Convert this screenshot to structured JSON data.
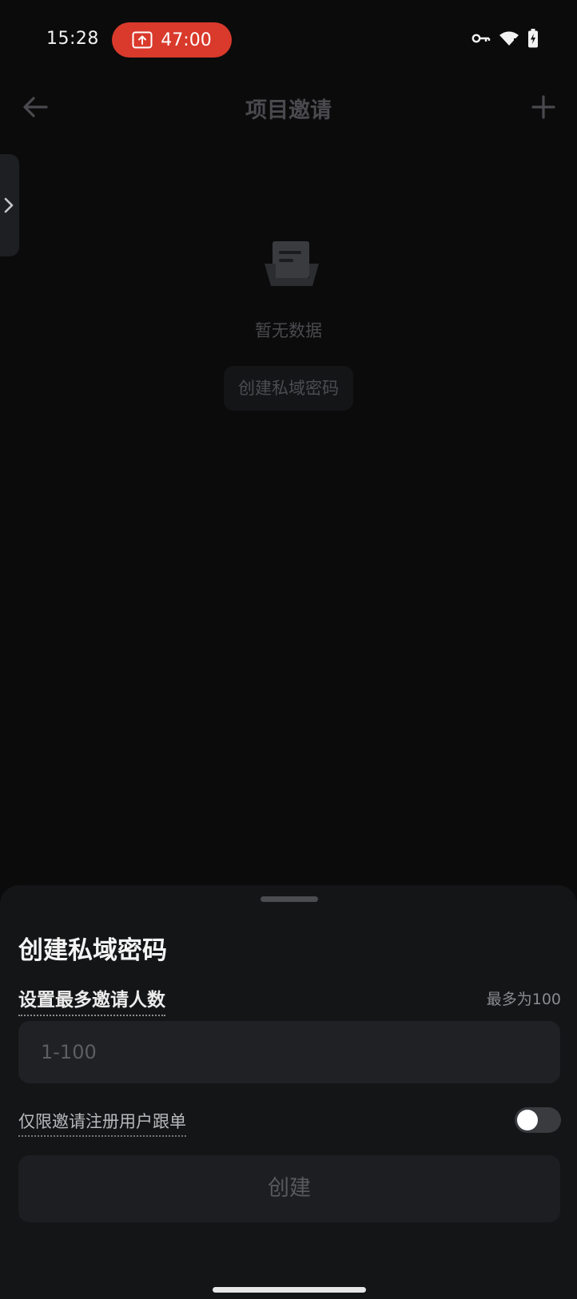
{
  "status_bar": {
    "time": "15:28",
    "recording_time": "47:00",
    "record_color": "#d93a2b",
    "icons": [
      "upload-screen-icon",
      "vpn-key-icon",
      "wifi-icon",
      "battery-charging-icon"
    ]
  },
  "header": {
    "title": "项目邀请",
    "back_icon": "arrow-left-icon",
    "add_icon": "plus-icon"
  },
  "side_tab": {
    "icon": "chevron-right-icon"
  },
  "empty_state": {
    "icon": "empty-inbox-icon",
    "text": "暂无数据",
    "button_label": "创建私域密码"
  },
  "sheet": {
    "title": "创建私域密码",
    "invite_label": "设置最多邀请人数",
    "invite_hint": "最多为100",
    "invite_placeholder": "1-100",
    "invite_value": "",
    "toggle_label": "仅限邀请注册用户跟单",
    "toggle_on": false,
    "create_label": "创建"
  }
}
